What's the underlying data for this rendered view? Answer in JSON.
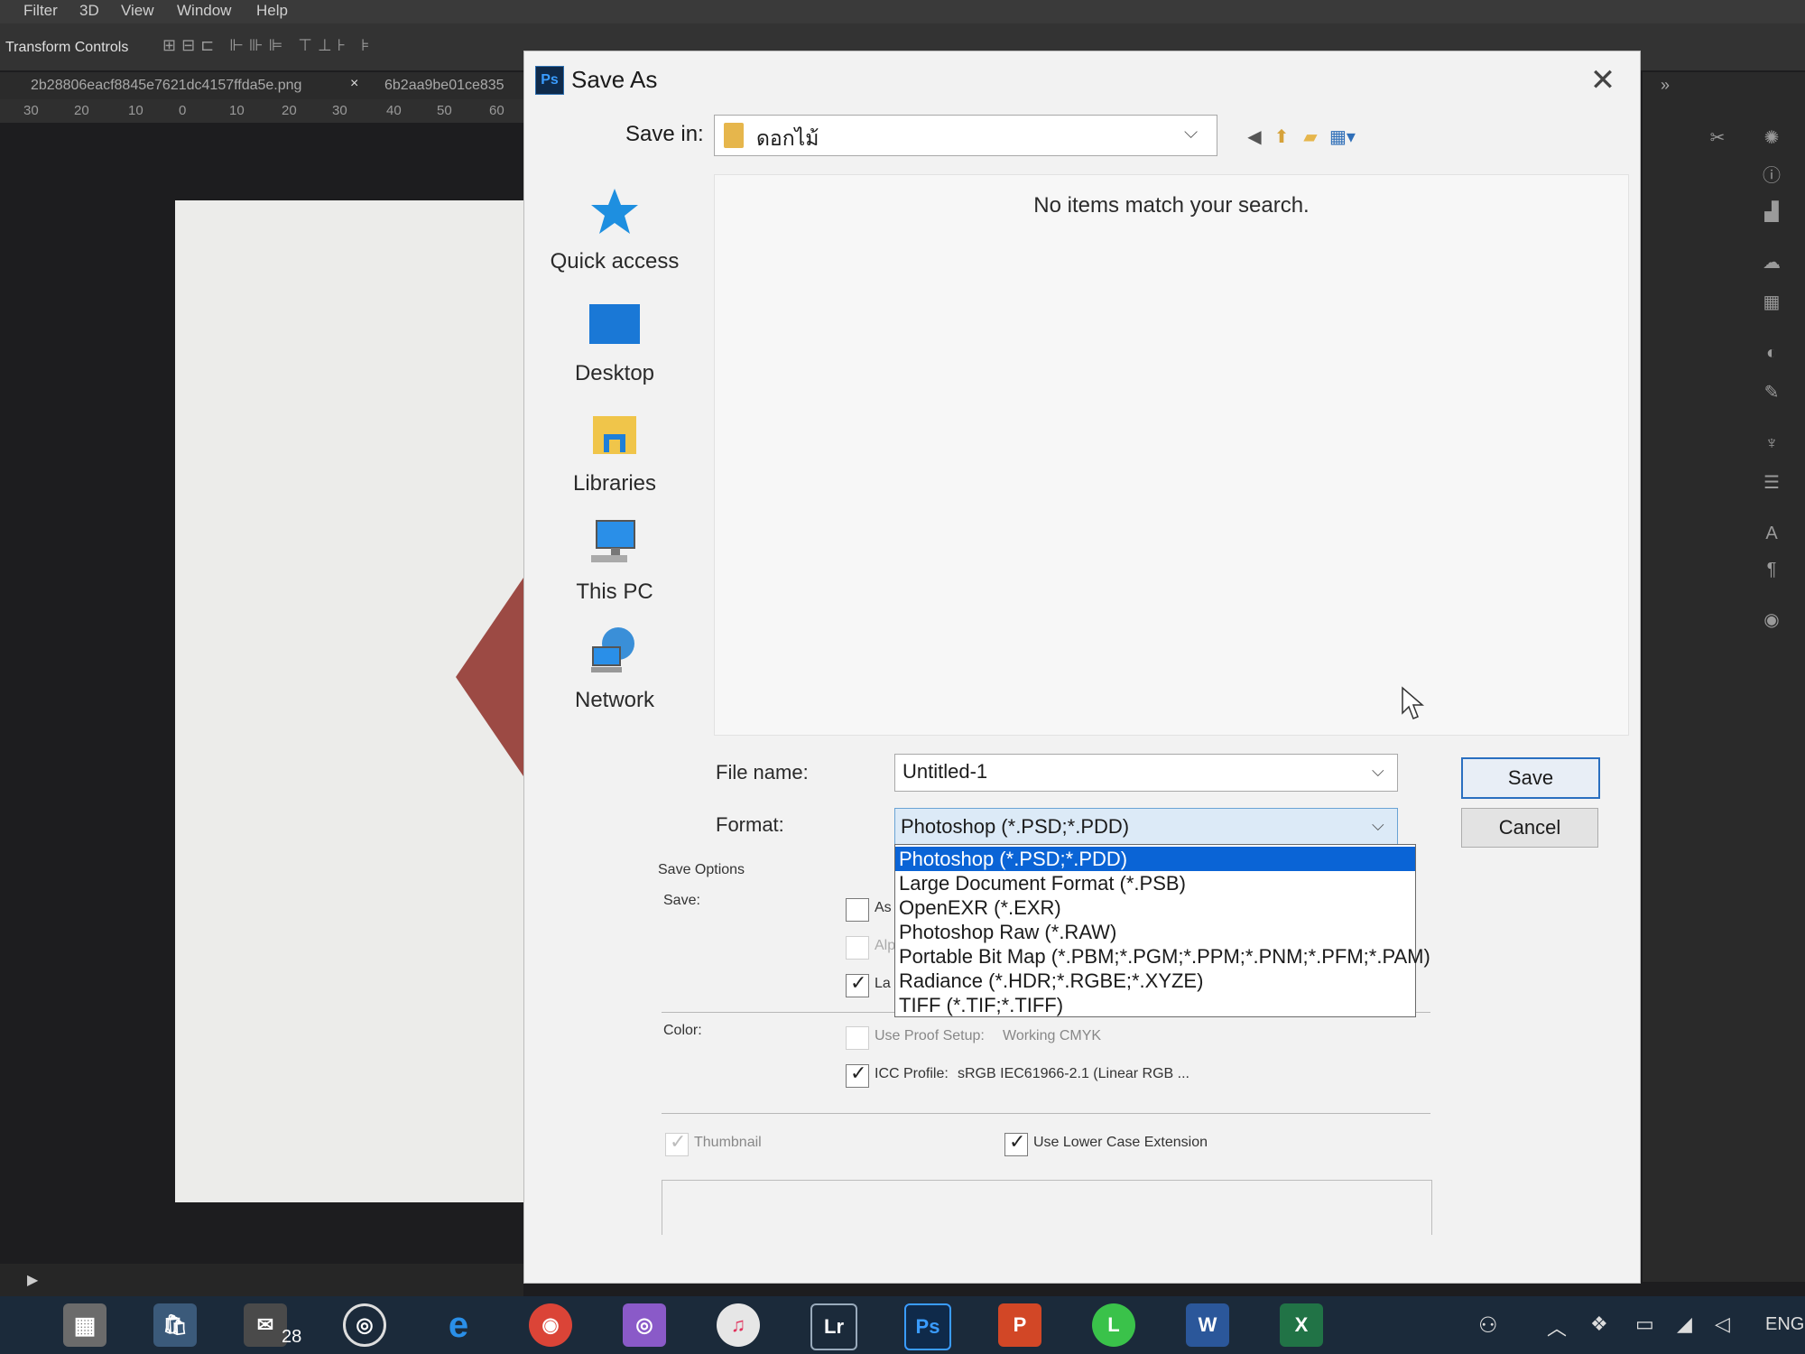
{
  "photoshop": {
    "menu": [
      "Filter",
      "3D",
      "View",
      "Window",
      "Help"
    ],
    "options_label": "Transform Controls",
    "tabs": [
      "2b28806eacf8845e7621dc4157ffda5e.png",
      "6b2aa9be01ce835"
    ],
    "ruler_ticks": [
      "30",
      "20",
      "10",
      "0",
      "10",
      "20",
      "30",
      "40",
      "50",
      "60"
    ]
  },
  "dialog": {
    "title": "Save As",
    "save_in_label": "Save in:",
    "save_in_value": "ดอกไม้",
    "empty_message": "No items match your search.",
    "sidebar": [
      {
        "label": "Quick access",
        "icon": "quick-access-icon"
      },
      {
        "label": "Desktop",
        "icon": "desktop-icon"
      },
      {
        "label": "Libraries",
        "icon": "libraries-icon"
      },
      {
        "label": "This PC",
        "icon": "this-pc-icon"
      },
      {
        "label": "Network",
        "icon": "network-icon"
      }
    ],
    "file_name_label": "File name:",
    "file_name_value": "Untitled-1",
    "format_label": "Format:",
    "format_value": "Photoshop (*.PSD;*.PDD)",
    "save_button": "Save",
    "cancel_button": "Cancel",
    "format_options": [
      "Photoshop (*.PSD;*.PDD)",
      "Large Document Format (*.PSB)",
      "OpenEXR (*.EXR)",
      "Photoshop Raw (*.RAW)",
      "Portable Bit Map (*.PBM;*.PGM;*.PPM;*.PNM;*.PFM;*.PAM)",
      "Radiance (*.HDR;*.RGBE;*.XYZE)",
      "TIFF (*.TIF;*.TIFF)"
    ],
    "save_options_heading": "Save Options",
    "save_label": "Save:",
    "partial_labels": [
      "As",
      "Alp",
      "La"
    ],
    "color_label": "Color:",
    "use_proof_setup": "Use Proof Setup:",
    "proof_value": "Working CMYK",
    "icc_profile": "ICC Profile:",
    "icc_value": "sRGB IEC61966-2.1 (Linear RGB ...",
    "thumbnail": "Thumbnail",
    "lower_case_ext": "Use Lower Case Extension"
  },
  "taskbar": {
    "mail_badge": "28",
    "lr_label": "Lr",
    "ps_label": "Ps",
    "lang": "ENG"
  },
  "colors": {
    "selection": "#0a64d6",
    "save_button_border": "#2a6fc0"
  }
}
